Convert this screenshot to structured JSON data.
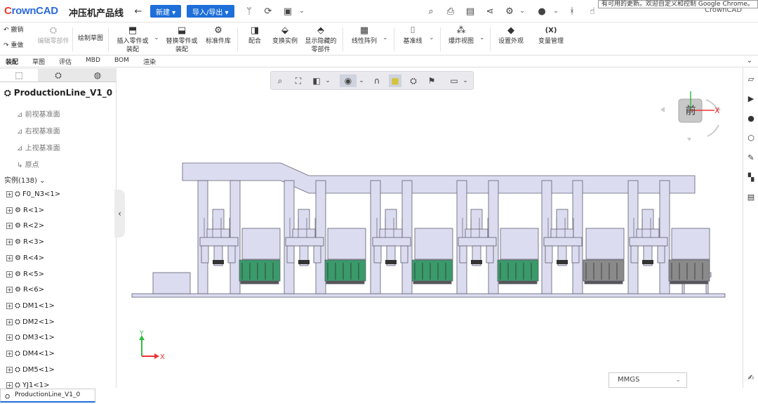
{
  "app": {
    "logo_first": "C",
    "logo_rest": "rownCAD",
    "project": "冲压机产品线"
  },
  "topbar": {
    "back_icon": "arrow-left-icon",
    "new_label": "新建 ▾",
    "import_export_label": "导入/导出 ▾",
    "right_text": "CrownCAD"
  },
  "browser_notice": "有可用的更新。欢迎自定义和控制 Google Chrome。",
  "ribbon": {
    "undo": "撤销",
    "redo": "重做",
    "edit_part": "编辑零部件",
    "sketch": "绘制草图",
    "insert_part_l1": "插入零件或",
    "insert_part_l2": "装配",
    "replace_part_l1": "替换零件或",
    "replace_part_l2": "装配",
    "std_lib": "标准件库",
    "mate": "配合",
    "transform": "变换实例",
    "show_hidden_l1": "显示隐藏的",
    "show_hidden_l2": "零部件",
    "linear_pattern": "线性阵列",
    "datum": "基准线",
    "explode": "爆炸视图",
    "appearance": "设置外观",
    "var_icon": "(X)",
    "variables": "变量管理"
  },
  "tabs": [
    "装配",
    "草图",
    "评估",
    "MBD",
    "BOM",
    "渲染"
  ],
  "tree": {
    "root": "ProductionLine_V1_0",
    "planes": [
      "前视基准面",
      "右视基准面",
      "上视基准面"
    ],
    "origin": "原点",
    "instances_label": "实例(138)",
    "nodes": [
      "F0_N3<1>",
      "R<1>",
      "R<2>",
      "R<3>",
      "R<4>",
      "R<5>",
      "R<6>",
      "DM1<1>",
      "DM2<1>",
      "DM3<1>",
      "DM4<1>",
      "DM5<1>",
      "YJ1<1>"
    ]
  },
  "viewcube": {
    "face": "前",
    "x": "X",
    "y": "Y"
  },
  "triad": {
    "x": "X",
    "y": "Y"
  },
  "units": "MMGS",
  "bottom_tab": "ProductionLine_V1_0",
  "colors": {
    "accent": "#1e6fd9",
    "body_fill": "#dcdcf0",
    "body_stroke": "#606070",
    "green_part": "#3a9a6a"
  }
}
